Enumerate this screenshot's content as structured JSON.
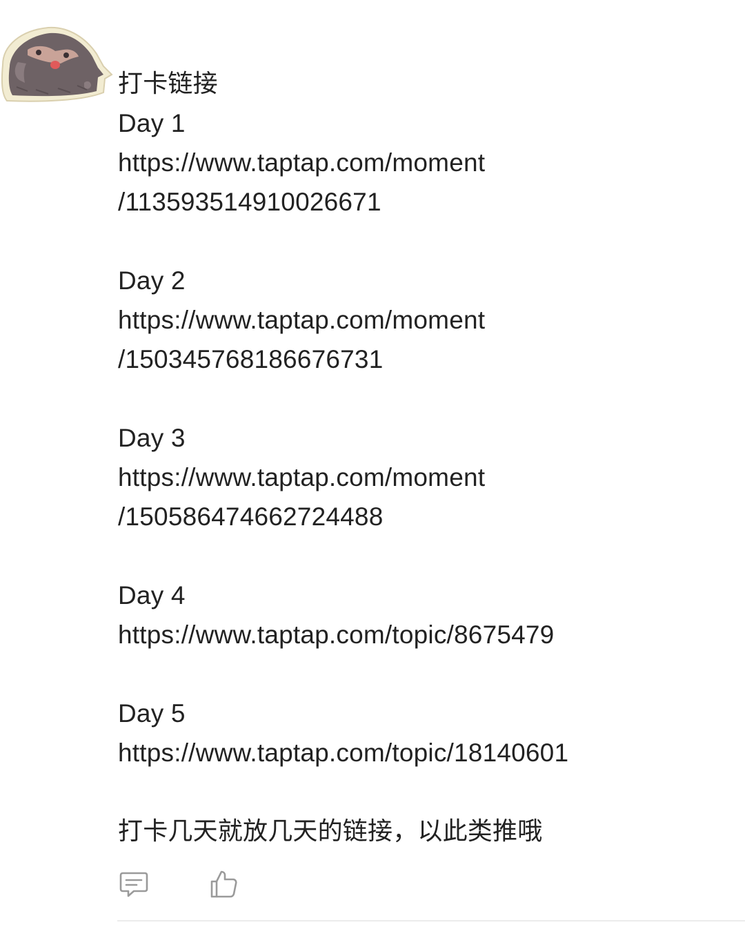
{
  "post": {
    "title": "打卡链接",
    "entries": [
      {
        "day": "Day 1",
        "url_line1": "https://www.taptap.com/moment",
        "url_line2": "/11359351491002667 1"
      },
      {
        "day": "Day 2",
        "url_line1": "https://www.taptap.com/moment",
        "url_line2": "/150345768186676731"
      },
      {
        "day": "Day 3",
        "url_line1": "https://www.taptap.com/moment",
        "url_line2": "/150586474662724488"
      },
      {
        "day": "Day 4",
        "url_line1": "https://www.taptap.com/topic/8675479"
      },
      {
        "day": "Day 5",
        "url_line1": "https://www.taptap.com/topic/18140601"
      }
    ],
    "closing": "打卡几天就放几天的链接，以此类推哦"
  },
  "actions": {
    "comment_icon": "comment-icon",
    "like_icon": "thumbs-up-icon"
  },
  "colors": {
    "text": "#222222",
    "icon": "#9a9a9a",
    "divider": "#ececec"
  }
}
